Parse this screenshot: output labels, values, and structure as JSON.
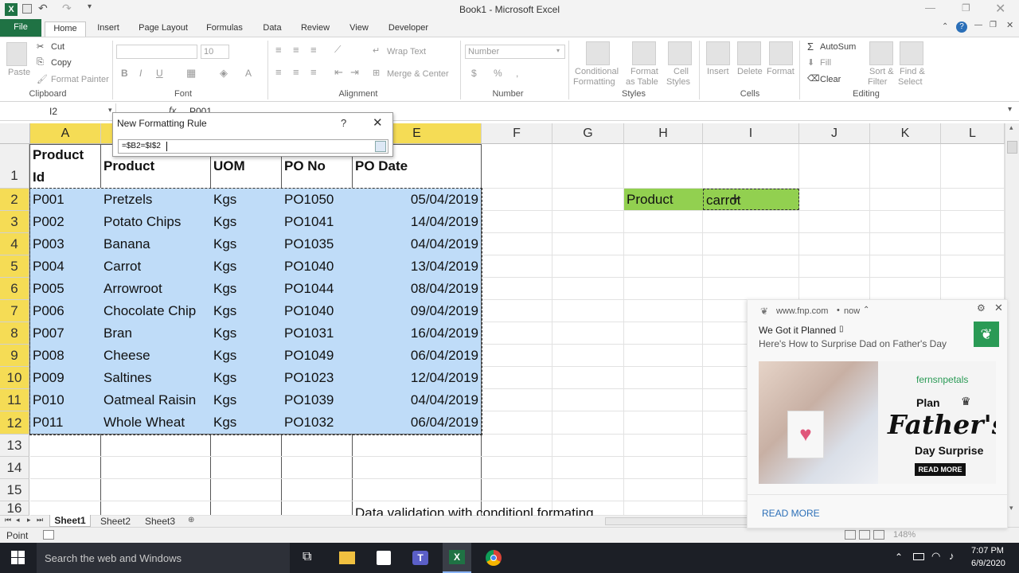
{
  "window": {
    "title": "Book1 - Microsoft Excel",
    "app_icon": "excel-icon",
    "quick_access": [
      "save-icon",
      "undo-icon",
      "redo-icon",
      "customize-icon"
    ]
  },
  "tabs": [
    "File",
    "Home",
    "Insert",
    "Page Layout",
    "Formulas",
    "Data",
    "Review",
    "View",
    "Developer"
  ],
  "active_tab": "Home",
  "ribbon": {
    "clipboard": {
      "paste": "Paste",
      "cut": "Cut",
      "copy": "Copy",
      "format_painter": "Format Painter",
      "group": "Clipboard"
    },
    "font": {
      "size": "10",
      "bold": "B",
      "italic": "I",
      "underline": "U",
      "font_color": "A",
      "group": "Font"
    },
    "alignment": {
      "wrap": "Wrap Text",
      "merge": "Merge & Center",
      "group": "Alignment"
    },
    "number": {
      "format": "Number",
      "currency": "$",
      "percent": "%",
      "comma": ",",
      "group": "Number"
    },
    "styles": {
      "conditional": [
        "Conditional",
        "Formatting"
      ],
      "format_table": [
        "Format",
        "as Table"
      ],
      "cell_styles": [
        "Cell",
        "Styles"
      ],
      "group": "Styles"
    },
    "cells": {
      "insert": "Insert",
      "delete": "Delete",
      "format": "Format",
      "group": "Cells"
    },
    "editing": {
      "autosum": "AutoSum",
      "fill": "Fill",
      "clear": "Clear",
      "sort": [
        "Sort &",
        "Filter"
      ],
      "find": [
        "Find &",
        "Select"
      ],
      "group": "Editing"
    }
  },
  "formula_bar": {
    "name_box": "I2",
    "fx": "fx",
    "value": "P001"
  },
  "dialog": {
    "title": "New Formatting Rule",
    "help": "?",
    "formula": "=$B2=$I$2"
  },
  "columns": [
    "A",
    "B",
    "C",
    "D",
    "E",
    "F",
    "G",
    "H",
    "I",
    "J",
    "K",
    "L"
  ],
  "rows": [
    "1",
    "2",
    "3",
    "4",
    "5",
    "6",
    "7",
    "8",
    "9",
    "10",
    "11",
    "12",
    "13",
    "14",
    "15",
    "16"
  ],
  "table": {
    "headers": [
      "Product Id",
      "Product",
      "UOM",
      "PO No",
      "PO Date"
    ],
    "header_a_lines": [
      "Product",
      "Id"
    ],
    "data": [
      [
        "P001",
        "Pretzels",
        "Kgs",
        "PO1050",
        "05/04/2019"
      ],
      [
        "P002",
        "Potato Chips",
        "Kgs",
        "PO1041",
        "14/04/2019"
      ],
      [
        "P003",
        "Banana",
        "Kgs",
        "PO1035",
        "04/04/2019"
      ],
      [
        "P004",
        "Carrot",
        "Kgs",
        "PO1040",
        "13/04/2019"
      ],
      [
        "P005",
        "Arrowroot",
        "Kgs",
        "PO1044",
        "08/04/2019"
      ],
      [
        "P006",
        "Chocolate Chip",
        "Kgs",
        "PO1040",
        "09/04/2019"
      ],
      [
        "P007",
        "Bran",
        "Kgs",
        "PO1031",
        "16/04/2019"
      ],
      [
        "P008",
        "Cheese",
        "Kgs",
        "PO1049",
        "06/04/2019"
      ],
      [
        "P009",
        "Saltines",
        "Kgs",
        "PO1023",
        "12/04/2019"
      ],
      [
        "P010",
        "Oatmeal Raisin",
        "Kgs",
        "PO1039",
        "04/04/2019"
      ],
      [
        "P011",
        "Whole Wheat",
        "Kgs",
        "PO1032",
        "06/04/2019"
      ]
    ]
  },
  "lookup": {
    "label": "Product",
    "value": "carrot"
  },
  "caption": "Data validation with conditionl formating",
  "sheets": [
    "Sheet1",
    "Sheet2",
    "Sheet3"
  ],
  "status": {
    "mode": "Point",
    "zoom": "148%"
  },
  "notification": {
    "source": "www.fnp.com",
    "time": "now",
    "title": "We Got it Planned",
    "body": "Here's How to Surprise Dad on Father's Day",
    "brand": "fernsnpetals",
    "ad_plan": "Plan",
    "ad_fathers": "Father's",
    "ad_surprise": "Day Surprise",
    "ad_button": "READ MORE",
    "action": "READ MORE"
  },
  "taskbar": {
    "search": "Search the web and Windows",
    "time": "7:07 PM",
    "date": "6/9/2020"
  },
  "colors": {
    "excel_green": "#1f7244",
    "selection_blue": "#bfdcf8",
    "header_yellow": "#f5dc55",
    "lookup_green": "#92d050"
  }
}
